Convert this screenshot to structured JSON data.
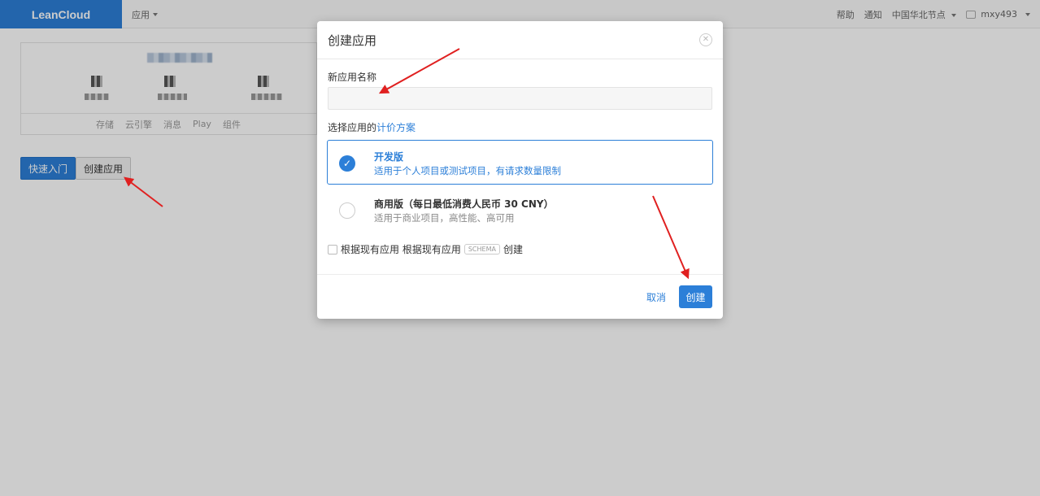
{
  "navbar": {
    "brand": "LeanCloud",
    "apps_menu": "应用",
    "help": "帮助",
    "notifications": "通知",
    "region": "中国华北节点",
    "username": "mxy493"
  },
  "app_card": {
    "tabs": [
      "存储",
      "云引擎",
      "消息",
      "Play",
      "组件"
    ]
  },
  "buttons": {
    "quick_start": "快速入门",
    "create_app": "创建应用"
  },
  "modal": {
    "title": "创建应用",
    "close_glyph": "✕",
    "name_label": "新应用名称",
    "name_value": "",
    "plan_label_prefix": "选择应用的",
    "plan_link": "计价方案",
    "plans": [
      {
        "title": "开发版",
        "desc": "适用于个人项目或测试项目，有请求数量限制",
        "selected": true
      },
      {
        "title": "商用版（每日最低消费人民币 30 CNY）",
        "desc": "适用于商业项目，高性能、高可用",
        "selected": false
      }
    ],
    "schema_prefix": "根据现有应用 根据现有应用",
    "schema_tag": "SCHEMA",
    "schema_suffix": "创建",
    "cancel": "取消",
    "submit": "创建"
  },
  "colors": {
    "accent": "#2c7fd8",
    "annotation": "#e02020"
  }
}
